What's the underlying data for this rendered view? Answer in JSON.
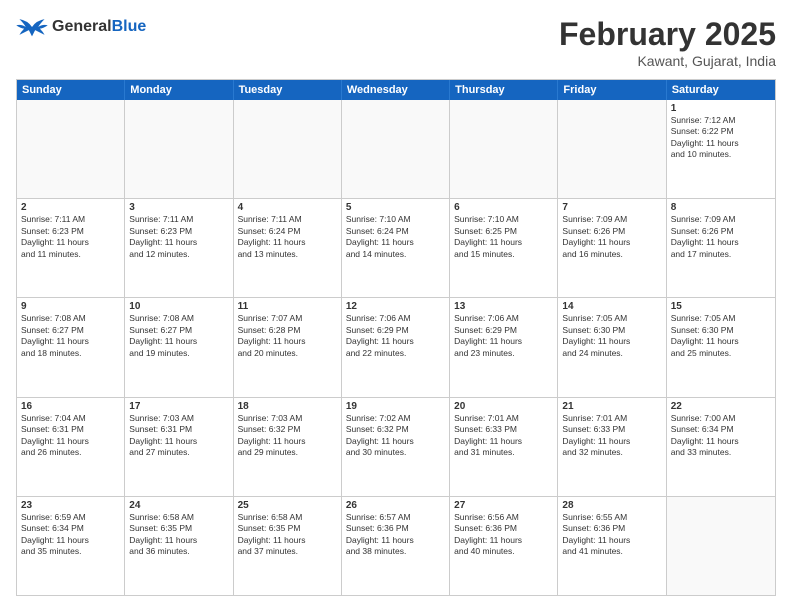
{
  "header": {
    "logo_general": "General",
    "logo_blue": "Blue",
    "month_title": "February 2025",
    "location": "Kawant, Gujarat, India"
  },
  "weekdays": [
    "Sunday",
    "Monday",
    "Tuesday",
    "Wednesday",
    "Thursday",
    "Friday",
    "Saturday"
  ],
  "rows": [
    [
      {
        "day": "",
        "info": ""
      },
      {
        "day": "",
        "info": ""
      },
      {
        "day": "",
        "info": ""
      },
      {
        "day": "",
        "info": ""
      },
      {
        "day": "",
        "info": ""
      },
      {
        "day": "",
        "info": ""
      },
      {
        "day": "1",
        "info": "Sunrise: 7:12 AM\nSunset: 6:22 PM\nDaylight: 11 hours\nand 10 minutes."
      }
    ],
    [
      {
        "day": "2",
        "info": "Sunrise: 7:11 AM\nSunset: 6:23 PM\nDaylight: 11 hours\nand 11 minutes."
      },
      {
        "day": "3",
        "info": "Sunrise: 7:11 AM\nSunset: 6:23 PM\nDaylight: 11 hours\nand 12 minutes."
      },
      {
        "day": "4",
        "info": "Sunrise: 7:11 AM\nSunset: 6:24 PM\nDaylight: 11 hours\nand 13 minutes."
      },
      {
        "day": "5",
        "info": "Sunrise: 7:10 AM\nSunset: 6:24 PM\nDaylight: 11 hours\nand 14 minutes."
      },
      {
        "day": "6",
        "info": "Sunrise: 7:10 AM\nSunset: 6:25 PM\nDaylight: 11 hours\nand 15 minutes."
      },
      {
        "day": "7",
        "info": "Sunrise: 7:09 AM\nSunset: 6:26 PM\nDaylight: 11 hours\nand 16 minutes."
      },
      {
        "day": "8",
        "info": "Sunrise: 7:09 AM\nSunset: 6:26 PM\nDaylight: 11 hours\nand 17 minutes."
      }
    ],
    [
      {
        "day": "9",
        "info": "Sunrise: 7:08 AM\nSunset: 6:27 PM\nDaylight: 11 hours\nand 18 minutes."
      },
      {
        "day": "10",
        "info": "Sunrise: 7:08 AM\nSunset: 6:27 PM\nDaylight: 11 hours\nand 19 minutes."
      },
      {
        "day": "11",
        "info": "Sunrise: 7:07 AM\nSunset: 6:28 PM\nDaylight: 11 hours\nand 20 minutes."
      },
      {
        "day": "12",
        "info": "Sunrise: 7:06 AM\nSunset: 6:29 PM\nDaylight: 11 hours\nand 22 minutes."
      },
      {
        "day": "13",
        "info": "Sunrise: 7:06 AM\nSunset: 6:29 PM\nDaylight: 11 hours\nand 23 minutes."
      },
      {
        "day": "14",
        "info": "Sunrise: 7:05 AM\nSunset: 6:30 PM\nDaylight: 11 hours\nand 24 minutes."
      },
      {
        "day": "15",
        "info": "Sunrise: 7:05 AM\nSunset: 6:30 PM\nDaylight: 11 hours\nand 25 minutes."
      }
    ],
    [
      {
        "day": "16",
        "info": "Sunrise: 7:04 AM\nSunset: 6:31 PM\nDaylight: 11 hours\nand 26 minutes."
      },
      {
        "day": "17",
        "info": "Sunrise: 7:03 AM\nSunset: 6:31 PM\nDaylight: 11 hours\nand 27 minutes."
      },
      {
        "day": "18",
        "info": "Sunrise: 7:03 AM\nSunset: 6:32 PM\nDaylight: 11 hours\nand 29 minutes."
      },
      {
        "day": "19",
        "info": "Sunrise: 7:02 AM\nSunset: 6:32 PM\nDaylight: 11 hours\nand 30 minutes."
      },
      {
        "day": "20",
        "info": "Sunrise: 7:01 AM\nSunset: 6:33 PM\nDaylight: 11 hours\nand 31 minutes."
      },
      {
        "day": "21",
        "info": "Sunrise: 7:01 AM\nSunset: 6:33 PM\nDaylight: 11 hours\nand 32 minutes."
      },
      {
        "day": "22",
        "info": "Sunrise: 7:00 AM\nSunset: 6:34 PM\nDaylight: 11 hours\nand 33 minutes."
      }
    ],
    [
      {
        "day": "23",
        "info": "Sunrise: 6:59 AM\nSunset: 6:34 PM\nDaylight: 11 hours\nand 35 minutes."
      },
      {
        "day": "24",
        "info": "Sunrise: 6:58 AM\nSunset: 6:35 PM\nDaylight: 11 hours\nand 36 minutes."
      },
      {
        "day": "25",
        "info": "Sunrise: 6:58 AM\nSunset: 6:35 PM\nDaylight: 11 hours\nand 37 minutes."
      },
      {
        "day": "26",
        "info": "Sunrise: 6:57 AM\nSunset: 6:36 PM\nDaylight: 11 hours\nand 38 minutes."
      },
      {
        "day": "27",
        "info": "Sunrise: 6:56 AM\nSunset: 6:36 PM\nDaylight: 11 hours\nand 40 minutes."
      },
      {
        "day": "28",
        "info": "Sunrise: 6:55 AM\nSunset: 6:36 PM\nDaylight: 11 hours\nand 41 minutes."
      },
      {
        "day": "",
        "info": ""
      }
    ]
  ]
}
